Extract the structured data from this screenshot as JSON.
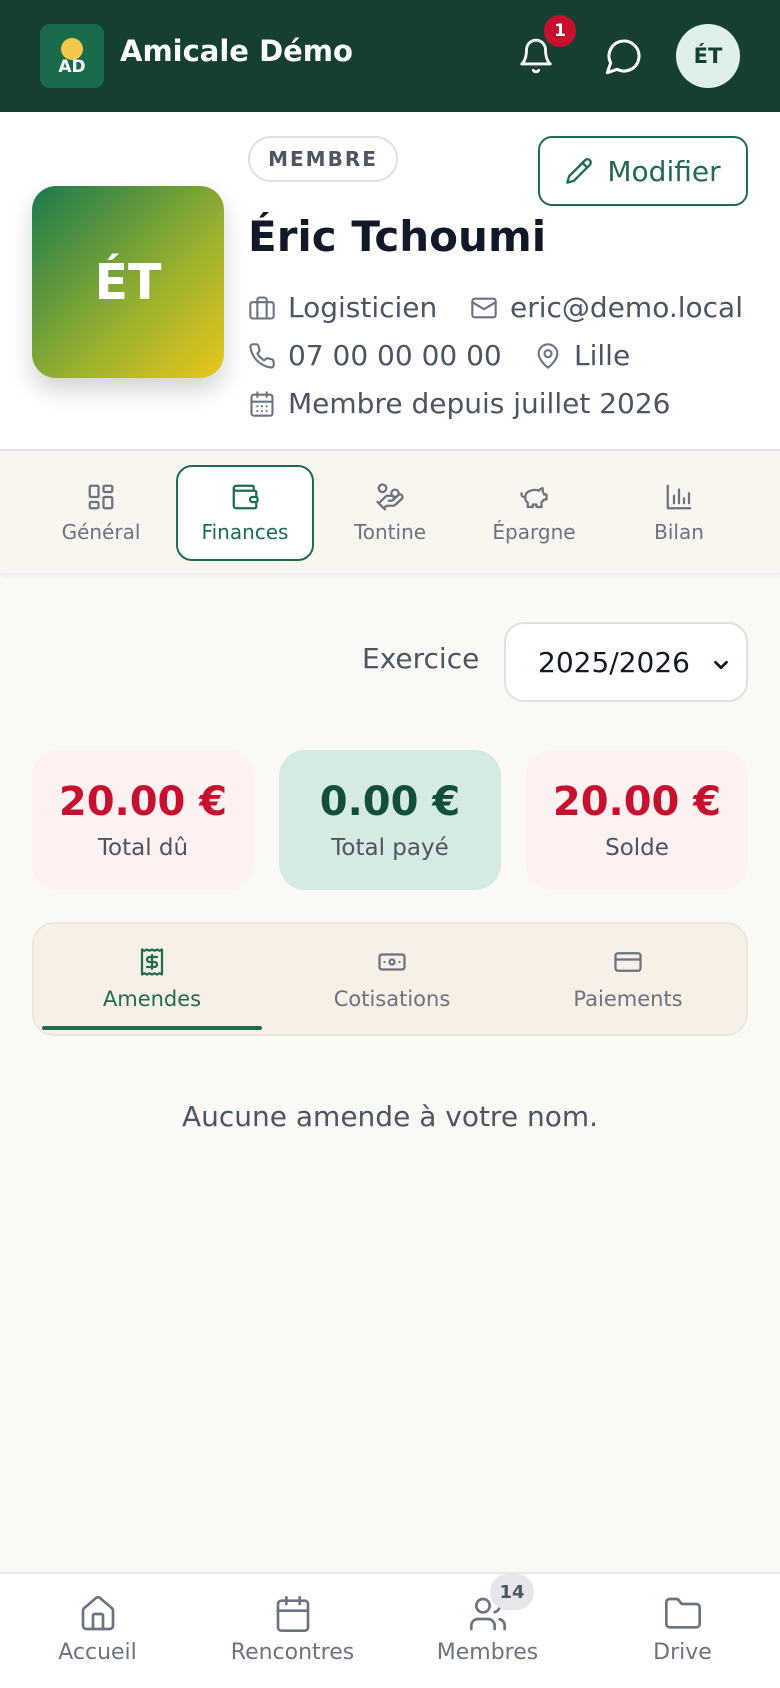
{
  "app": {
    "logo_text": "AD",
    "title": "Amicale Démo",
    "notification_count": "1",
    "user_initials": "ÉT"
  },
  "profile": {
    "initials": "ÉT",
    "role_badge": "MEMBRE",
    "edit_label": "Modifier",
    "name": "Éric Tchoumi",
    "job": "Logisticien",
    "email": "eric@demo.local",
    "phone": "07 00 00 00 00",
    "city": "Lille",
    "member_since": "Membre depuis juillet 2026"
  },
  "section_tabs": [
    {
      "label": "Général",
      "icon": "grid-icon",
      "active": false
    },
    {
      "label": "Finances",
      "icon": "wallet-icon",
      "active": true
    },
    {
      "label": "Tontine",
      "icon": "hand-coins-icon",
      "active": false
    },
    {
      "label": "Épargne",
      "icon": "piggy-bank-icon",
      "active": false
    },
    {
      "label": "Bilan",
      "icon": "bar-chart-icon",
      "active": false
    }
  ],
  "exercice": {
    "label": "Exercice",
    "selected": "2025/2026"
  },
  "summary": [
    {
      "amount": "20.00 €",
      "label": "Total dû"
    },
    {
      "amount": "0.00 €",
      "label": "Total payé"
    },
    {
      "amount": "20.00 €",
      "label": "Solde"
    }
  ],
  "sub_tabs": [
    {
      "label": "Amendes",
      "icon": "receipt-icon",
      "active": true
    },
    {
      "label": "Cotisations",
      "icon": "banknote-icon",
      "active": false
    },
    {
      "label": "Paiements",
      "icon": "credit-card-icon",
      "active": false
    }
  ],
  "empty_message": "Aucune amende à votre nom.",
  "bottom_nav": [
    {
      "label": "Accueil",
      "icon": "home-icon"
    },
    {
      "label": "Rencontres",
      "icon": "calendar-icon"
    },
    {
      "label": "Membres",
      "icon": "users-icon",
      "badge": "14"
    },
    {
      "label": "Drive",
      "icon": "folder-icon"
    }
  ],
  "colors": {
    "brand_dark": "#163f33",
    "accent": "#1f6b4e",
    "danger": "#c8102e"
  }
}
